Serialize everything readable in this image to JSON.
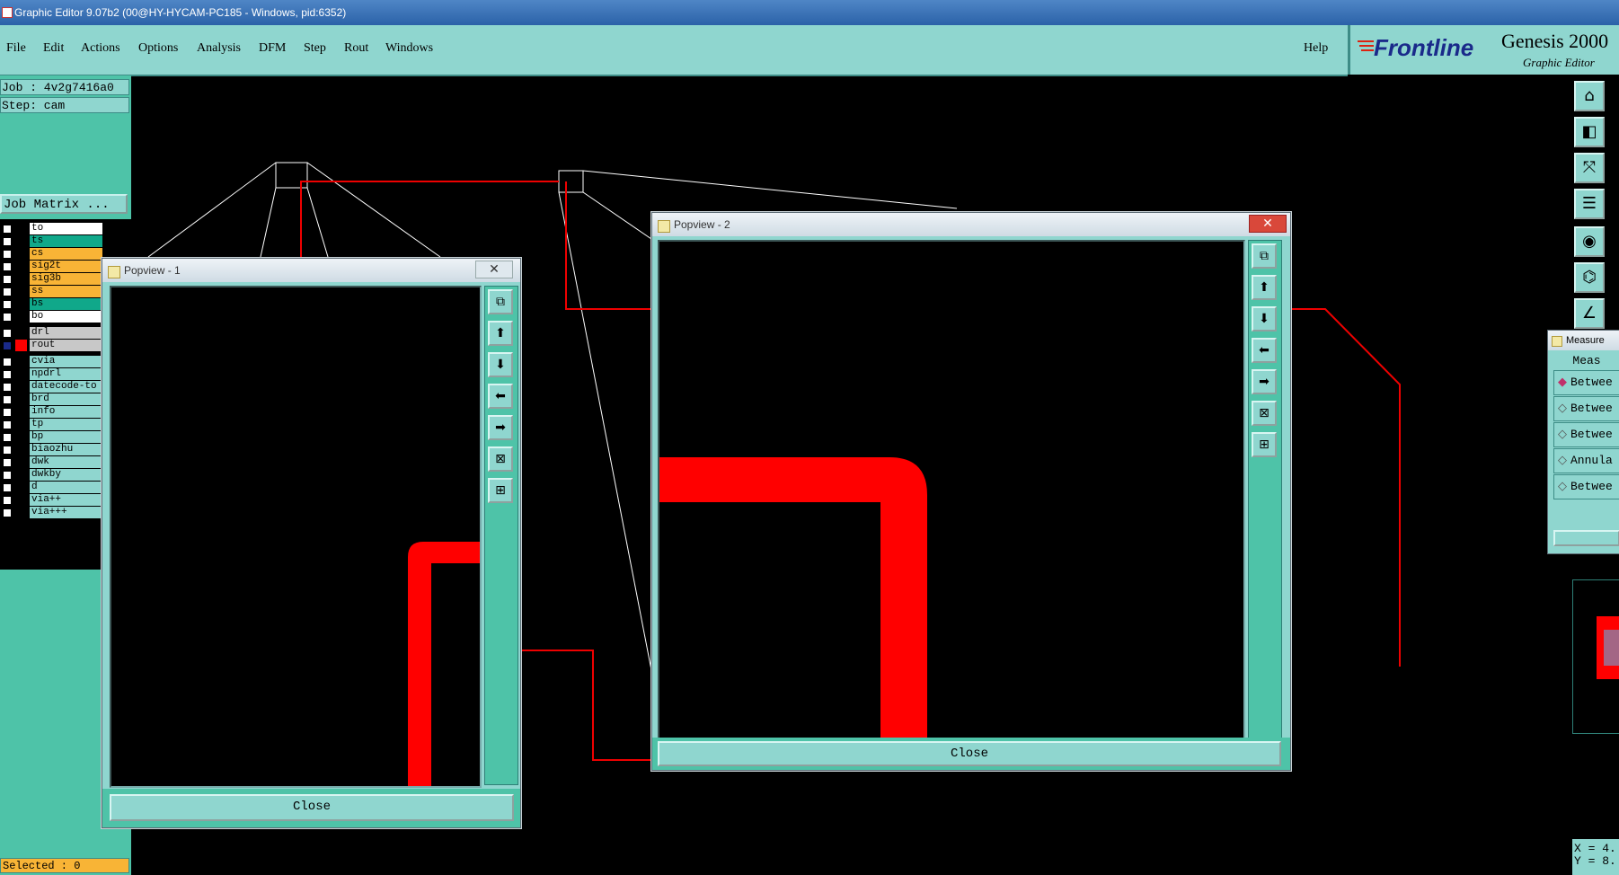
{
  "window": {
    "title": "Graphic Editor 9.07b2 (00@HY-HYCAM-PC185 - Windows, pid:6352)"
  },
  "menu": {
    "items": [
      "File",
      "Edit",
      "Actions",
      "Options",
      "Analysis",
      "DFM",
      "Step",
      "Rout",
      "Windows"
    ],
    "help": "Help"
  },
  "brand": {
    "logo": "Frontline",
    "product": "Genesis 2000",
    "subtitle": "Graphic Editor"
  },
  "left_panel": {
    "job": "Job : 4v2g7416a0",
    "step": "Step: cam",
    "job_matrix_button": "Job Matrix ...",
    "layers": [
      {
        "name": "to",
        "color": "#ffffff"
      },
      {
        "name": "ts",
        "color": "#10a88a"
      },
      {
        "name": "cs",
        "color": "#f8b436"
      },
      {
        "name": "sig2t",
        "color": "#f8b436"
      },
      {
        "name": "sig3b",
        "color": "#f8b436"
      },
      {
        "name": "ss",
        "color": "#f8b436"
      },
      {
        "name": "bs",
        "color": "#10a88a"
      },
      {
        "name": "bo",
        "color": "#ffffff"
      },
      {
        "name": "drl",
        "color": "#c8c8c8"
      },
      {
        "name": "rout",
        "color": "#c8c8c8",
        "active": true
      },
      {
        "name": "cvia",
        "color": "#8fd6cf"
      },
      {
        "name": "npdrl",
        "color": "#8fd6cf"
      },
      {
        "name": "datecode-to",
        "color": "#8fd6cf"
      },
      {
        "name": "brd",
        "color": "#8fd6cf"
      },
      {
        "name": "info",
        "color": "#8fd6cf"
      },
      {
        "name": "tp",
        "color": "#8fd6cf"
      },
      {
        "name": "bp",
        "color": "#8fd6cf"
      },
      {
        "name": "biaozhu",
        "color": "#8fd6cf"
      },
      {
        "name": "dwk",
        "color": "#8fd6cf"
      },
      {
        "name": "dwkby",
        "color": "#8fd6cf"
      },
      {
        "name": "d",
        "color": "#8fd6cf"
      },
      {
        "name": "via++",
        "color": "#8fd6cf"
      },
      {
        "name": "via+++",
        "color": "#8fd6cf"
      }
    ],
    "selected": "Selected : 0"
  },
  "popview1": {
    "title": "Popview - 1",
    "close_label": "Close"
  },
  "popview2": {
    "title": "Popview - 2",
    "close_label": "Close"
  },
  "measure": {
    "title": "Measure",
    "header": "Meas",
    "options": [
      "Betwee",
      "Betwee",
      "Betwee",
      "Annula",
      "Betwee"
    ]
  },
  "coords": {
    "x": "X = 4.",
    "y": "Y = 8."
  },
  "colors": {
    "accent": "#8fd6cf",
    "panel": "#4ec3a8",
    "feature": "#ff0000"
  }
}
